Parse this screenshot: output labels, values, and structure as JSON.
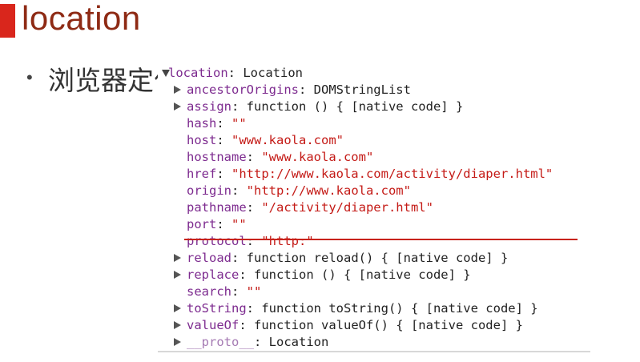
{
  "slide": {
    "title": "location",
    "bullet_char": "•",
    "bullet_text": "浏览器定位"
  },
  "console": {
    "root": {
      "key": "location",
      "sep": ": ",
      "type": "Location"
    },
    "props": [
      {
        "key": "ancestorOrigins",
        "sep": ": ",
        "value": "DOMStringList",
        "kind": "type",
        "expandable": true
      },
      {
        "key": "assign",
        "sep": ": ",
        "value": "function () { [native code] }",
        "kind": "type",
        "expandable": true
      },
      {
        "key": "hash",
        "sep": ": ",
        "value": "\"\"",
        "kind": "string",
        "expandable": false
      },
      {
        "key": "host",
        "sep": ": ",
        "value": "\"www.kaola.com\"",
        "kind": "string",
        "expandable": false
      },
      {
        "key": "hostname",
        "sep": ": ",
        "value": "\"www.kaola.com\"",
        "kind": "string",
        "expandable": false
      },
      {
        "key": "href",
        "sep": ": ",
        "value": "\"http://www.kaola.com/activity/diaper.html\"",
        "kind": "string",
        "expandable": false
      },
      {
        "key": "origin",
        "sep": ": ",
        "value": "\"http://www.kaola.com\"",
        "kind": "string",
        "expandable": false
      },
      {
        "key": "pathname",
        "sep": ": ",
        "value": "\"/activity/diaper.html\"",
        "kind": "string",
        "expandable": false
      },
      {
        "key": "port",
        "sep": ": ",
        "value": "\"\"",
        "kind": "string",
        "expandable": false
      },
      {
        "key": "protocol",
        "sep": ": ",
        "value": "\"http:\"",
        "kind": "string",
        "expandable": false
      },
      {
        "key": "reload",
        "sep": ": ",
        "value": "function reload() { [native code] }",
        "kind": "type",
        "expandable": true
      },
      {
        "key": "replace",
        "sep": ": ",
        "value": "function () { [native code] }",
        "kind": "type",
        "expandable": true
      },
      {
        "key": "search",
        "sep": ": ",
        "value": "\"\"",
        "kind": "string",
        "expandable": false
      },
      {
        "key": "toString",
        "sep": ": ",
        "value": "function toString() { [native code] }",
        "kind": "type",
        "expandable": true
      },
      {
        "key": "valueOf",
        "sep": ": ",
        "value": "function valueOf() { [native code] }",
        "kind": "type",
        "expandable": true
      },
      {
        "key": "__proto__",
        "sep": ": ",
        "value": "Location",
        "kind": "type",
        "expandable": true,
        "dim": true
      }
    ],
    "highlighted_key": "href"
  },
  "colors": {
    "accent": "#d9261c",
    "title": "#8e2a14",
    "property_key": "#7d2b8f",
    "string_value": "#c41a16",
    "highlight_underline": "#c8231b"
  }
}
